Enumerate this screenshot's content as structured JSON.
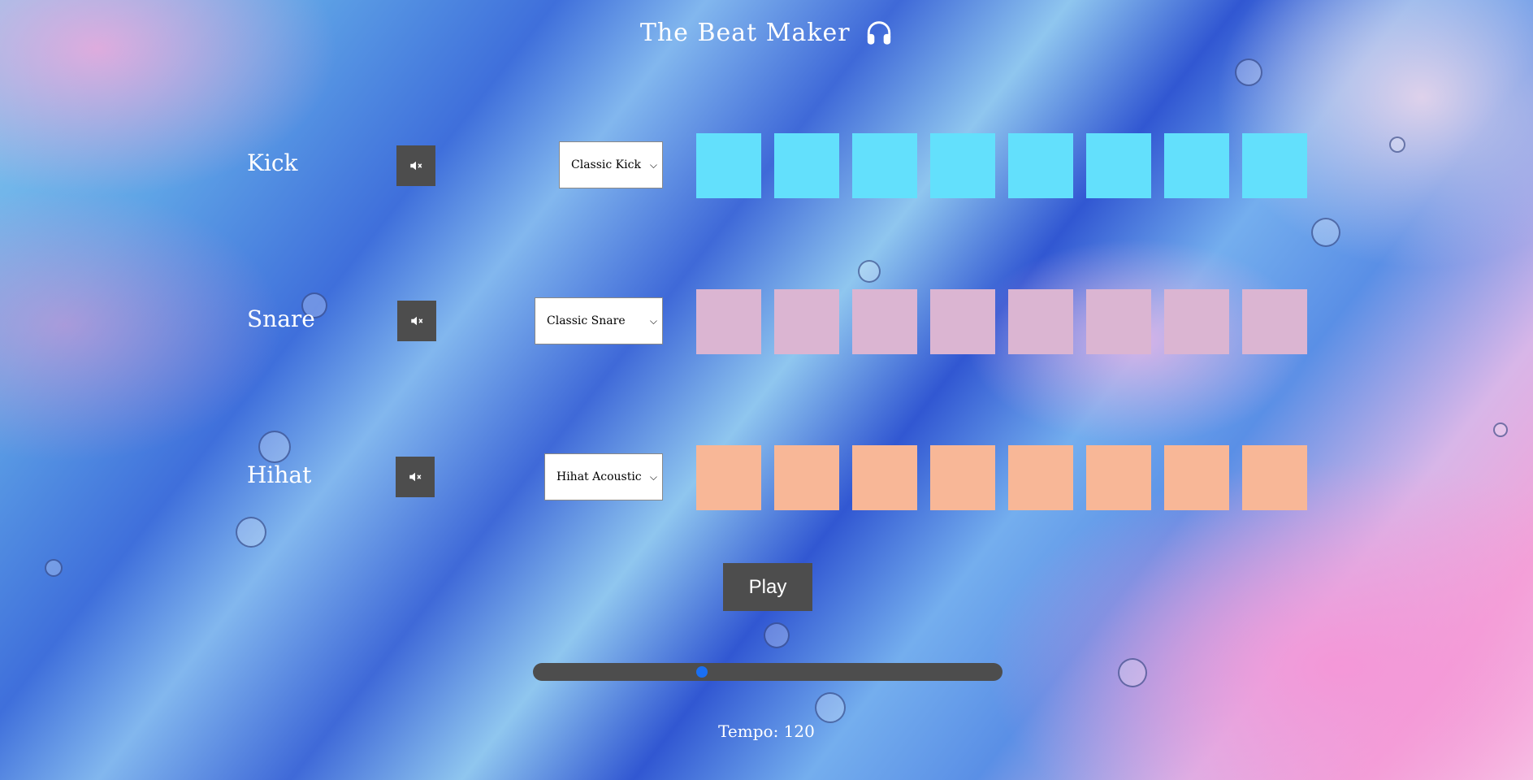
{
  "app": {
    "title": "The Beat Maker",
    "title_icon": "headphones-icon"
  },
  "tracks": [
    {
      "label": "Kick",
      "mute_icon": "mute-speaker-icon",
      "selected_sound": "Classic Kick",
      "pad_color": "#63e0fc",
      "pad_count": 8
    },
    {
      "label": "Snare",
      "mute_icon": "mute-speaker-icon",
      "selected_sound": "Classic Snare",
      "pad_color": "#dbb5d2",
      "pad_count": 8
    },
    {
      "label": "Hihat",
      "mute_icon": "mute-speaker-icon",
      "selected_sound": "Hihat Acoustic",
      "pad_color": "#f8b797",
      "pad_count": 8
    }
  ],
  "controls": {
    "play_label": "Play",
    "tempo_text": "Tempo: 120",
    "tempo_slider_fraction": 0.36
  },
  "colors": {
    "button_bg": "#4d4d4d",
    "slider_thumb": "#1a6ff2"
  }
}
